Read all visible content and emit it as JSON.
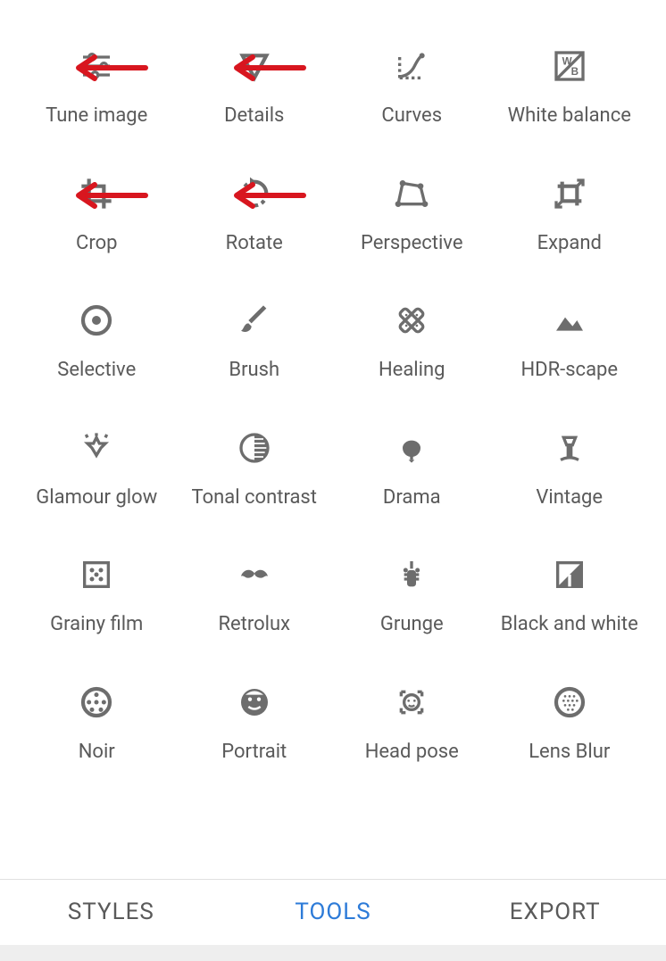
{
  "tools": [
    {
      "id": "tune-image",
      "label": "Tune image",
      "arrow": true
    },
    {
      "id": "details",
      "label": "Details",
      "arrow": true
    },
    {
      "id": "curves",
      "label": "Curves",
      "arrow": false
    },
    {
      "id": "white-balance",
      "label": "White balance",
      "arrow": false
    },
    {
      "id": "crop",
      "label": "Crop",
      "arrow": true
    },
    {
      "id": "rotate",
      "label": "Rotate",
      "arrow": true
    },
    {
      "id": "perspective",
      "label": "Perspective",
      "arrow": false
    },
    {
      "id": "expand",
      "label": "Expand",
      "arrow": false
    },
    {
      "id": "selective",
      "label": "Selective",
      "arrow": false
    },
    {
      "id": "brush",
      "label": "Brush",
      "arrow": false
    },
    {
      "id": "healing",
      "label": "Healing",
      "arrow": false
    },
    {
      "id": "hdr-scape",
      "label": "HDR-scape",
      "arrow": false
    },
    {
      "id": "glamour-glow",
      "label": "Glamour glow",
      "arrow": false
    },
    {
      "id": "tonal-contrast",
      "label": "Tonal contrast",
      "arrow": false
    },
    {
      "id": "drama",
      "label": "Drama",
      "arrow": false
    },
    {
      "id": "vintage",
      "label": "Vintage",
      "arrow": false
    },
    {
      "id": "grainy-film",
      "label": "Grainy film",
      "arrow": false
    },
    {
      "id": "retrolux",
      "label": "Retrolux",
      "arrow": false
    },
    {
      "id": "grunge",
      "label": "Grunge",
      "arrow": false
    },
    {
      "id": "black-and-white",
      "label": "Black and white",
      "arrow": false
    },
    {
      "id": "noir",
      "label": "Noir",
      "arrow": false
    },
    {
      "id": "portrait",
      "label": "Portrait",
      "arrow": false
    },
    {
      "id": "head-pose",
      "label": "Head pose",
      "arrow": false
    },
    {
      "id": "lens-blur",
      "label": "Lens Blur",
      "arrow": false
    }
  ],
  "tabs": {
    "styles": "STYLES",
    "tools": "TOOLS",
    "export": "EXPORT",
    "active": "tools"
  },
  "colors": {
    "icon": "#6d6d6d",
    "arrow": "#d8161f",
    "accent": "#2d7bd8"
  }
}
